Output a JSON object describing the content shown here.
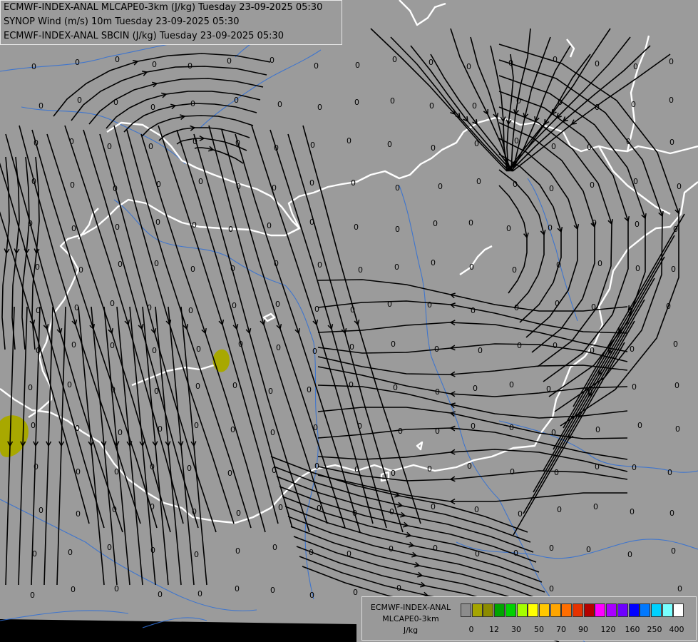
{
  "header": {
    "line1": "ECMWF-INDEX-ANAL MLCAPE0-3km (J/kg) Tuesday 23-09-2025 05:30",
    "line2": "SYNOP Wind (m/s) 10m Tuesday 23-09-2025 05:30",
    "line3": "ECMWF-INDEX-ANAL SBCIN (J/kg) Tuesday 23-09-2025 05:30"
  },
  "legend": {
    "title1": "ECMWF-INDEX-ANAL",
    "title2": "MLCAPE0-3km",
    "unit": "J/kg",
    "colors": [
      "#8c8c8c",
      "#a5a500",
      "#8c8c00",
      "#00a500",
      "#00d200",
      "#a5ff00",
      "#ffff00",
      "#ffc800",
      "#ffa500",
      "#ff6e00",
      "#e63200",
      "#b40000",
      "#ff00ff",
      "#aa00ff",
      "#6e00ff",
      "#0000ff",
      "#0078ff",
      "#00d2ff",
      "#78ffff",
      "#ffffff"
    ],
    "tick_labels": [
      "0",
      "12",
      "30",
      "50",
      "70",
      "90",
      "120",
      "160",
      "250",
      "400"
    ]
  },
  "map": {
    "value_label": "0",
    "colors": {
      "background": "#9b9b9b",
      "border": "#ffffff",
      "river": "#2f6fd6",
      "streamline": "#000000",
      "cape_blob": "#a8a800"
    }
  }
}
